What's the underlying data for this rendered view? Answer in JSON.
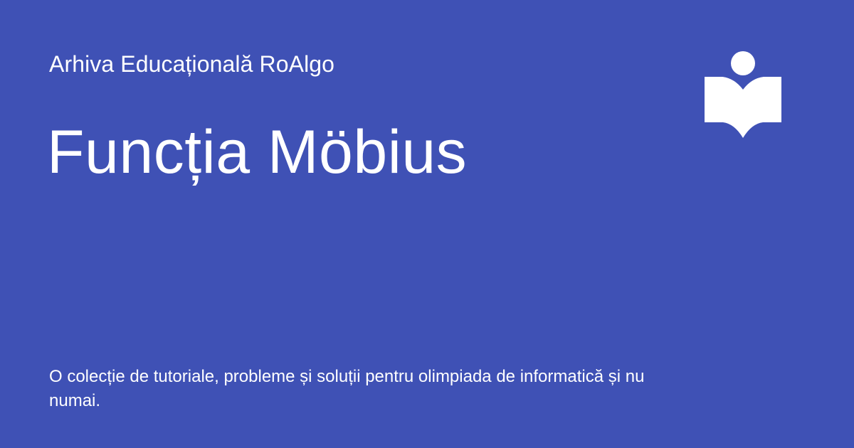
{
  "header": {
    "site_name": "Arhiva Educațională RoAlgo"
  },
  "main": {
    "title": "Funcția Möbius",
    "description": "O colecție de tutoriale, probleme și soluții pentru olimpiada de informatică și nu numai."
  },
  "logo": {
    "icon": "reader-book-icon"
  },
  "colors": {
    "background": "#3f51b5",
    "foreground": "#ffffff"
  }
}
